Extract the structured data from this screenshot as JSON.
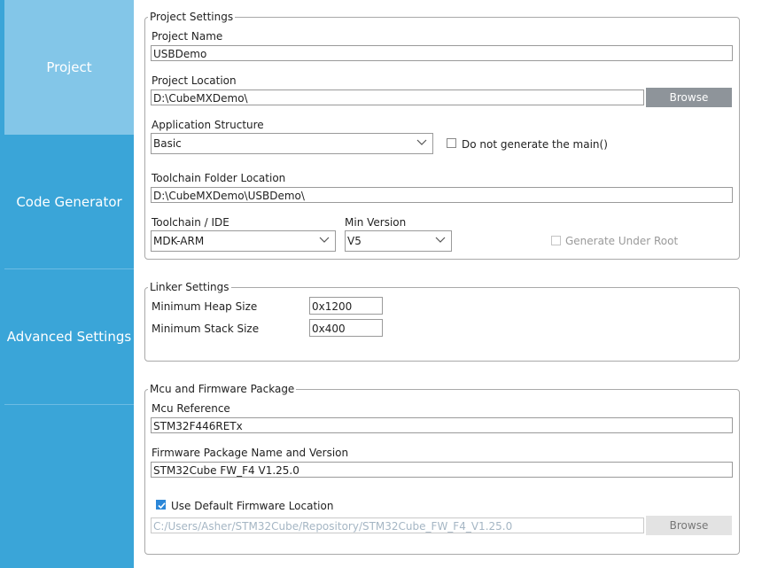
{
  "sidebar": {
    "items": [
      {
        "label": "Project"
      },
      {
        "label": "Code Generator"
      },
      {
        "label": "Advanced Settings"
      }
    ]
  },
  "project_settings": {
    "legend": "Project Settings",
    "project_name_label": "Project Name",
    "project_name_value": "USBDemo",
    "project_location_label": "Project Location",
    "project_location_value": "D:\\CubeMXDemo\\",
    "browse_label": "Browse",
    "app_structure_label": "Application Structure",
    "app_structure_value": "Basic",
    "no_main_label": "Do not generate the main()",
    "toolchain_folder_label": "Toolchain Folder Location",
    "toolchain_folder_value": "D:\\CubeMXDemo\\USBDemo\\",
    "toolchain_ide_label": "Toolchain / IDE",
    "toolchain_ide_value": "MDK-ARM",
    "min_version_label": "Min Version",
    "min_version_value": "V5",
    "generate_under_root_label": "Generate Under Root"
  },
  "linker_settings": {
    "legend": "Linker Settings",
    "heap_label": "Minimum Heap Size",
    "heap_value": "0x1200",
    "stack_label": "Minimum Stack Size",
    "stack_value": "0x400"
  },
  "mcu_firmware": {
    "legend": "Mcu and Firmware Package",
    "mcu_ref_label": "Mcu Reference",
    "mcu_ref_value": "STM32F446RETx",
    "fw_pkg_label": "Firmware Package Name and Version",
    "fw_pkg_value": "STM32Cube FW_F4 V1.25.0",
    "use_default_label": "Use Default Firmware Location",
    "fw_location_value": "C:/Users/Asher/STM32Cube/Repository/STM32Cube_FW_F4_V1.25.0",
    "browse_label": "Browse"
  }
}
